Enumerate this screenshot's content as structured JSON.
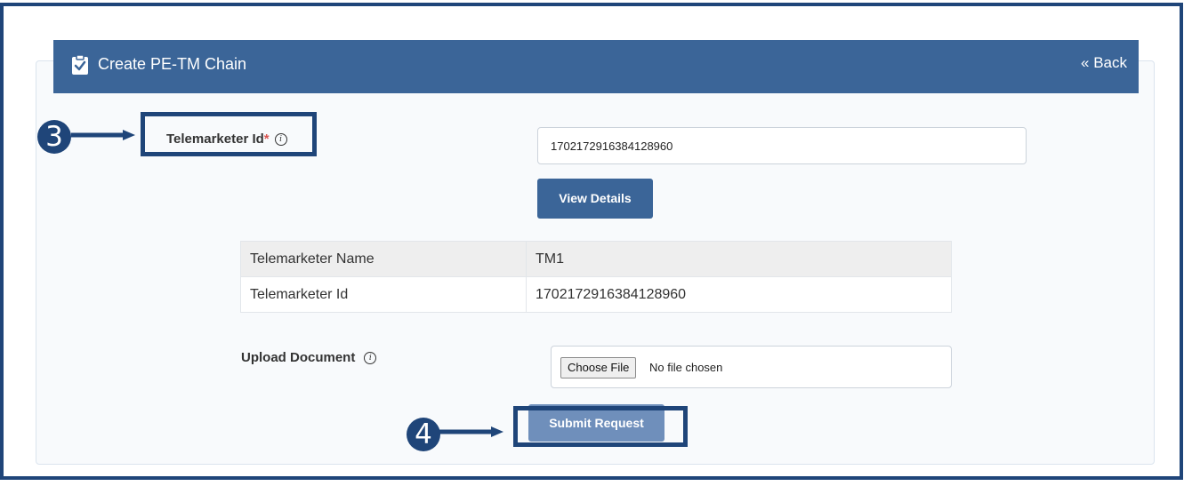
{
  "header": {
    "title": "Create PE-TM Chain",
    "back_label": "« Back",
    "bg_color": "#3b6598"
  },
  "form": {
    "telemarketer_id": {
      "label": "Telemarketer Id",
      "required_mark": "*",
      "value": "1702172916384128960"
    },
    "view_details_label": "View Details",
    "details_table": {
      "rows": [
        {
          "key": "Telemarketer Name",
          "value": "TM1"
        },
        {
          "key": "Telemarketer Id",
          "value": "1702172916384128960"
        }
      ]
    },
    "upload": {
      "label": "Upload Document",
      "choose_label": "Choose File",
      "status": "No file chosen"
    },
    "submit_label": "Submit Request"
  },
  "annotations": {
    "step3": "3",
    "step4": "4",
    "color": "#1f4579"
  },
  "icons": {
    "info": "i",
    "clipboard": "clipboard-check-icon"
  }
}
